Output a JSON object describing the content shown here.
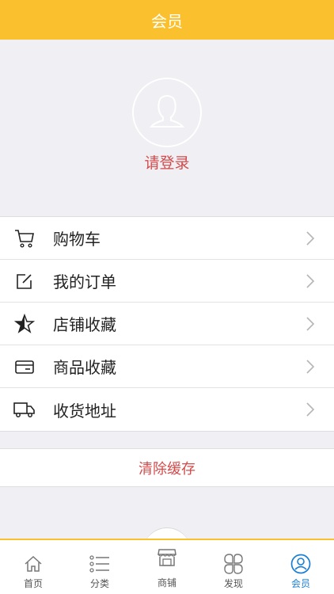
{
  "header": {
    "title": "会员"
  },
  "profile": {
    "login_label": "请登录"
  },
  "menu": {
    "items": [
      {
        "label": "购物车",
        "icon": "cart-icon"
      },
      {
        "label": "我的订单",
        "icon": "edit-icon"
      },
      {
        "label": "店铺收藏",
        "icon": "star-icon"
      },
      {
        "label": "商品收藏",
        "icon": "card-icon"
      },
      {
        "label": "收货地址",
        "icon": "truck-icon"
      }
    ]
  },
  "actions": {
    "clear_cache": "清除缓存"
  },
  "tabbar": {
    "items": [
      {
        "label": "首页",
        "icon": "home-icon"
      },
      {
        "label": "分类",
        "icon": "list-icon"
      },
      {
        "label": "商铺",
        "icon": "store-icon"
      },
      {
        "label": "发现",
        "icon": "clover-icon"
      },
      {
        "label": "会员",
        "icon": "user-icon",
        "active": true
      }
    ]
  },
  "colors": {
    "accent": "#fbc02d",
    "danger_text": "#d34a4a",
    "active_tab": "#1a7fd4"
  }
}
